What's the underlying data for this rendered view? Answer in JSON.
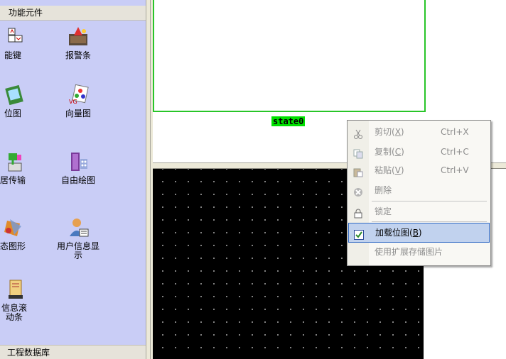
{
  "left_panel": {
    "header": "功能元件",
    "footer": "工程数据库",
    "tools": [
      {
        "label": "能键",
        "icon": "function-key-icon"
      },
      {
        "label": "报警条",
        "icon": "alarm-bar-icon"
      },
      {
        "label": "位图",
        "icon": "bitmap-icon"
      },
      {
        "label": "向量图",
        "icon": "vector-graph-icon"
      },
      {
        "label": "居传输",
        "icon": "data-transfer-icon"
      },
      {
        "label": "自由绘图",
        "icon": "free-draw-icon"
      },
      {
        "label": "态图形",
        "icon": "dynamic-graphic-icon"
      },
      {
        "label": "用户信息显示",
        "icon": "user-info-icon"
      },
      {
        "label": "信息滚动条",
        "icon": "info-scroll-icon"
      }
    ]
  },
  "canvas": {
    "state_label": "state0"
  },
  "context_menu": {
    "items": [
      {
        "label": "剪切(X)",
        "text": "剪切(",
        "key": "X",
        "shortcut": "Ctrl+X",
        "icon": "scissors-icon",
        "enabled": false
      },
      {
        "label": "复制(C)",
        "text": "复制(",
        "key": "C",
        "shortcut": "Ctrl+C",
        "icon": "copy-icon",
        "enabled": false
      },
      {
        "label": "粘贴(V)",
        "text": "粘贴(",
        "key": "V",
        "shortcut": "Ctrl+V",
        "icon": "paste-icon",
        "enabled": false
      },
      {
        "label": "删除",
        "text": "删除",
        "icon": "delete-icon",
        "enabled": false
      },
      {
        "label": "锁定",
        "text": "锁定",
        "icon": "lock-icon",
        "enabled": false
      },
      {
        "label": "加载位图(B)",
        "text": "加载位图(",
        "key": "B",
        "icon": "checkbox-icon",
        "enabled": true,
        "highlighted": true
      },
      {
        "label": "使用扩展存储图片",
        "text": "使用扩展存储图片",
        "enabled": false
      }
    ]
  },
  "colors": {
    "panel_bg": "#c9cdf6",
    "state_frame": "#28c528",
    "state_label_bg": "#00e000",
    "menu_highlight": "#c1d2ee"
  }
}
